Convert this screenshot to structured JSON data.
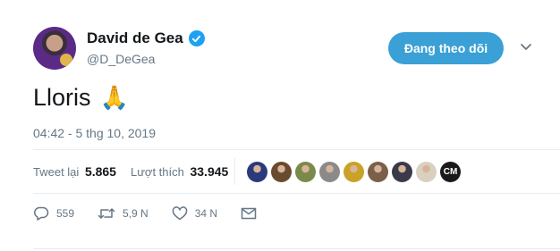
{
  "user": {
    "name": "David de Gea",
    "handle": "@D_DeGea"
  },
  "follow_button_label": "Đang theo dõi",
  "tweet": {
    "text": "Lloris",
    "emoji": "🙏",
    "timestamp": "04:42 - 5 thg 10, 2019"
  },
  "stats": {
    "retweets_label": "Tweet lại",
    "retweets_count": "5.865",
    "likes_label": "Lượt thích",
    "likes_count": "33.945"
  },
  "likers": [
    {
      "color": "#2b3a7a"
    },
    {
      "color": "#6a4a2e"
    },
    {
      "color": "#7a8a4a"
    },
    {
      "color": "#8a8a8a"
    },
    {
      "color": "#c9a227"
    },
    {
      "color": "#7a6048"
    },
    {
      "color": "#3a3a4a"
    },
    {
      "color": "#d9d0c0"
    },
    {
      "label": "CM",
      "color": "#1a1a1a"
    }
  ],
  "actions": {
    "reply_count": "559",
    "retweet_count": "5,9 N",
    "like_count": "34 N"
  },
  "colors": {
    "accent": "#1da1f2",
    "follow_button": "#3aa0d5",
    "muted": "#657786"
  }
}
